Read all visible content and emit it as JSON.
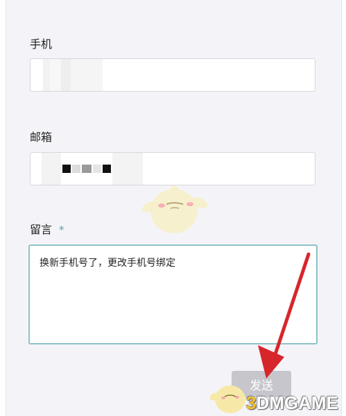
{
  "form": {
    "phone_label": "手机",
    "email_label": "邮箱",
    "message_label": "留言",
    "required_mark": "*",
    "message_value": "换新手机号了，更改手机号绑定",
    "send_label": "发送"
  },
  "watermark": {
    "prefix": "3",
    "text": "DMGAME"
  },
  "colors": {
    "background": "#f4f4f8",
    "accent_border": "#8cc2c6",
    "button_disabled": "#c6c6cc",
    "arrow": "#d7262b"
  }
}
